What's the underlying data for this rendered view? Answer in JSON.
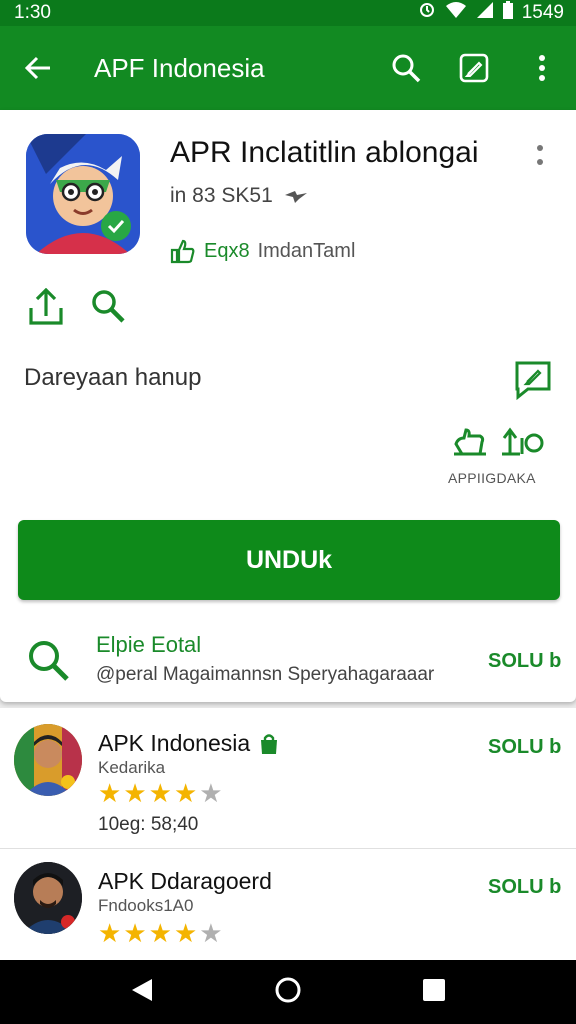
{
  "status_bar": {
    "time": "1:30",
    "battery": "1549"
  },
  "app_bar": {
    "title": "APF Indonesia"
  },
  "app": {
    "name": "APR Inclatitlin ablongai",
    "meta": "in 83 SK51",
    "tag_highlight": "Eqx8",
    "tag_rest": "ImdanTaml",
    "description": "Dareyaan hanup",
    "stats_label": "APPIIGDAKA",
    "install_label": "UNDUk"
  },
  "search_suggestion": {
    "title": "Elpie Eotal",
    "subtitle": "@peral Magaimannsn Speryahagaraaar",
    "action_label": "SOLU b"
  },
  "results": [
    {
      "title": "APK Indonesia",
      "subtitle": "Kedarika",
      "rating": 4,
      "meta": "10eg: 58;40",
      "action_label": "SOLU b"
    },
    {
      "title": "APK Ddaragoerd",
      "subtitle": "Fndooks1A0",
      "rating": 4,
      "meta": "",
      "action_label": "SOLU b"
    }
  ],
  "colors": {
    "accent": "#128a22",
    "status_bar": "#0b7a1b",
    "star": "#f4b400"
  },
  "icons": [
    "arrow-back-icon",
    "search-icon",
    "edit-icon",
    "more-vert-icon",
    "share-icon",
    "feedback-icon",
    "thumbs-up-icon",
    "play-arrow-icon",
    "nav-back-icon",
    "nav-home-icon",
    "nav-recents-icon"
  ]
}
